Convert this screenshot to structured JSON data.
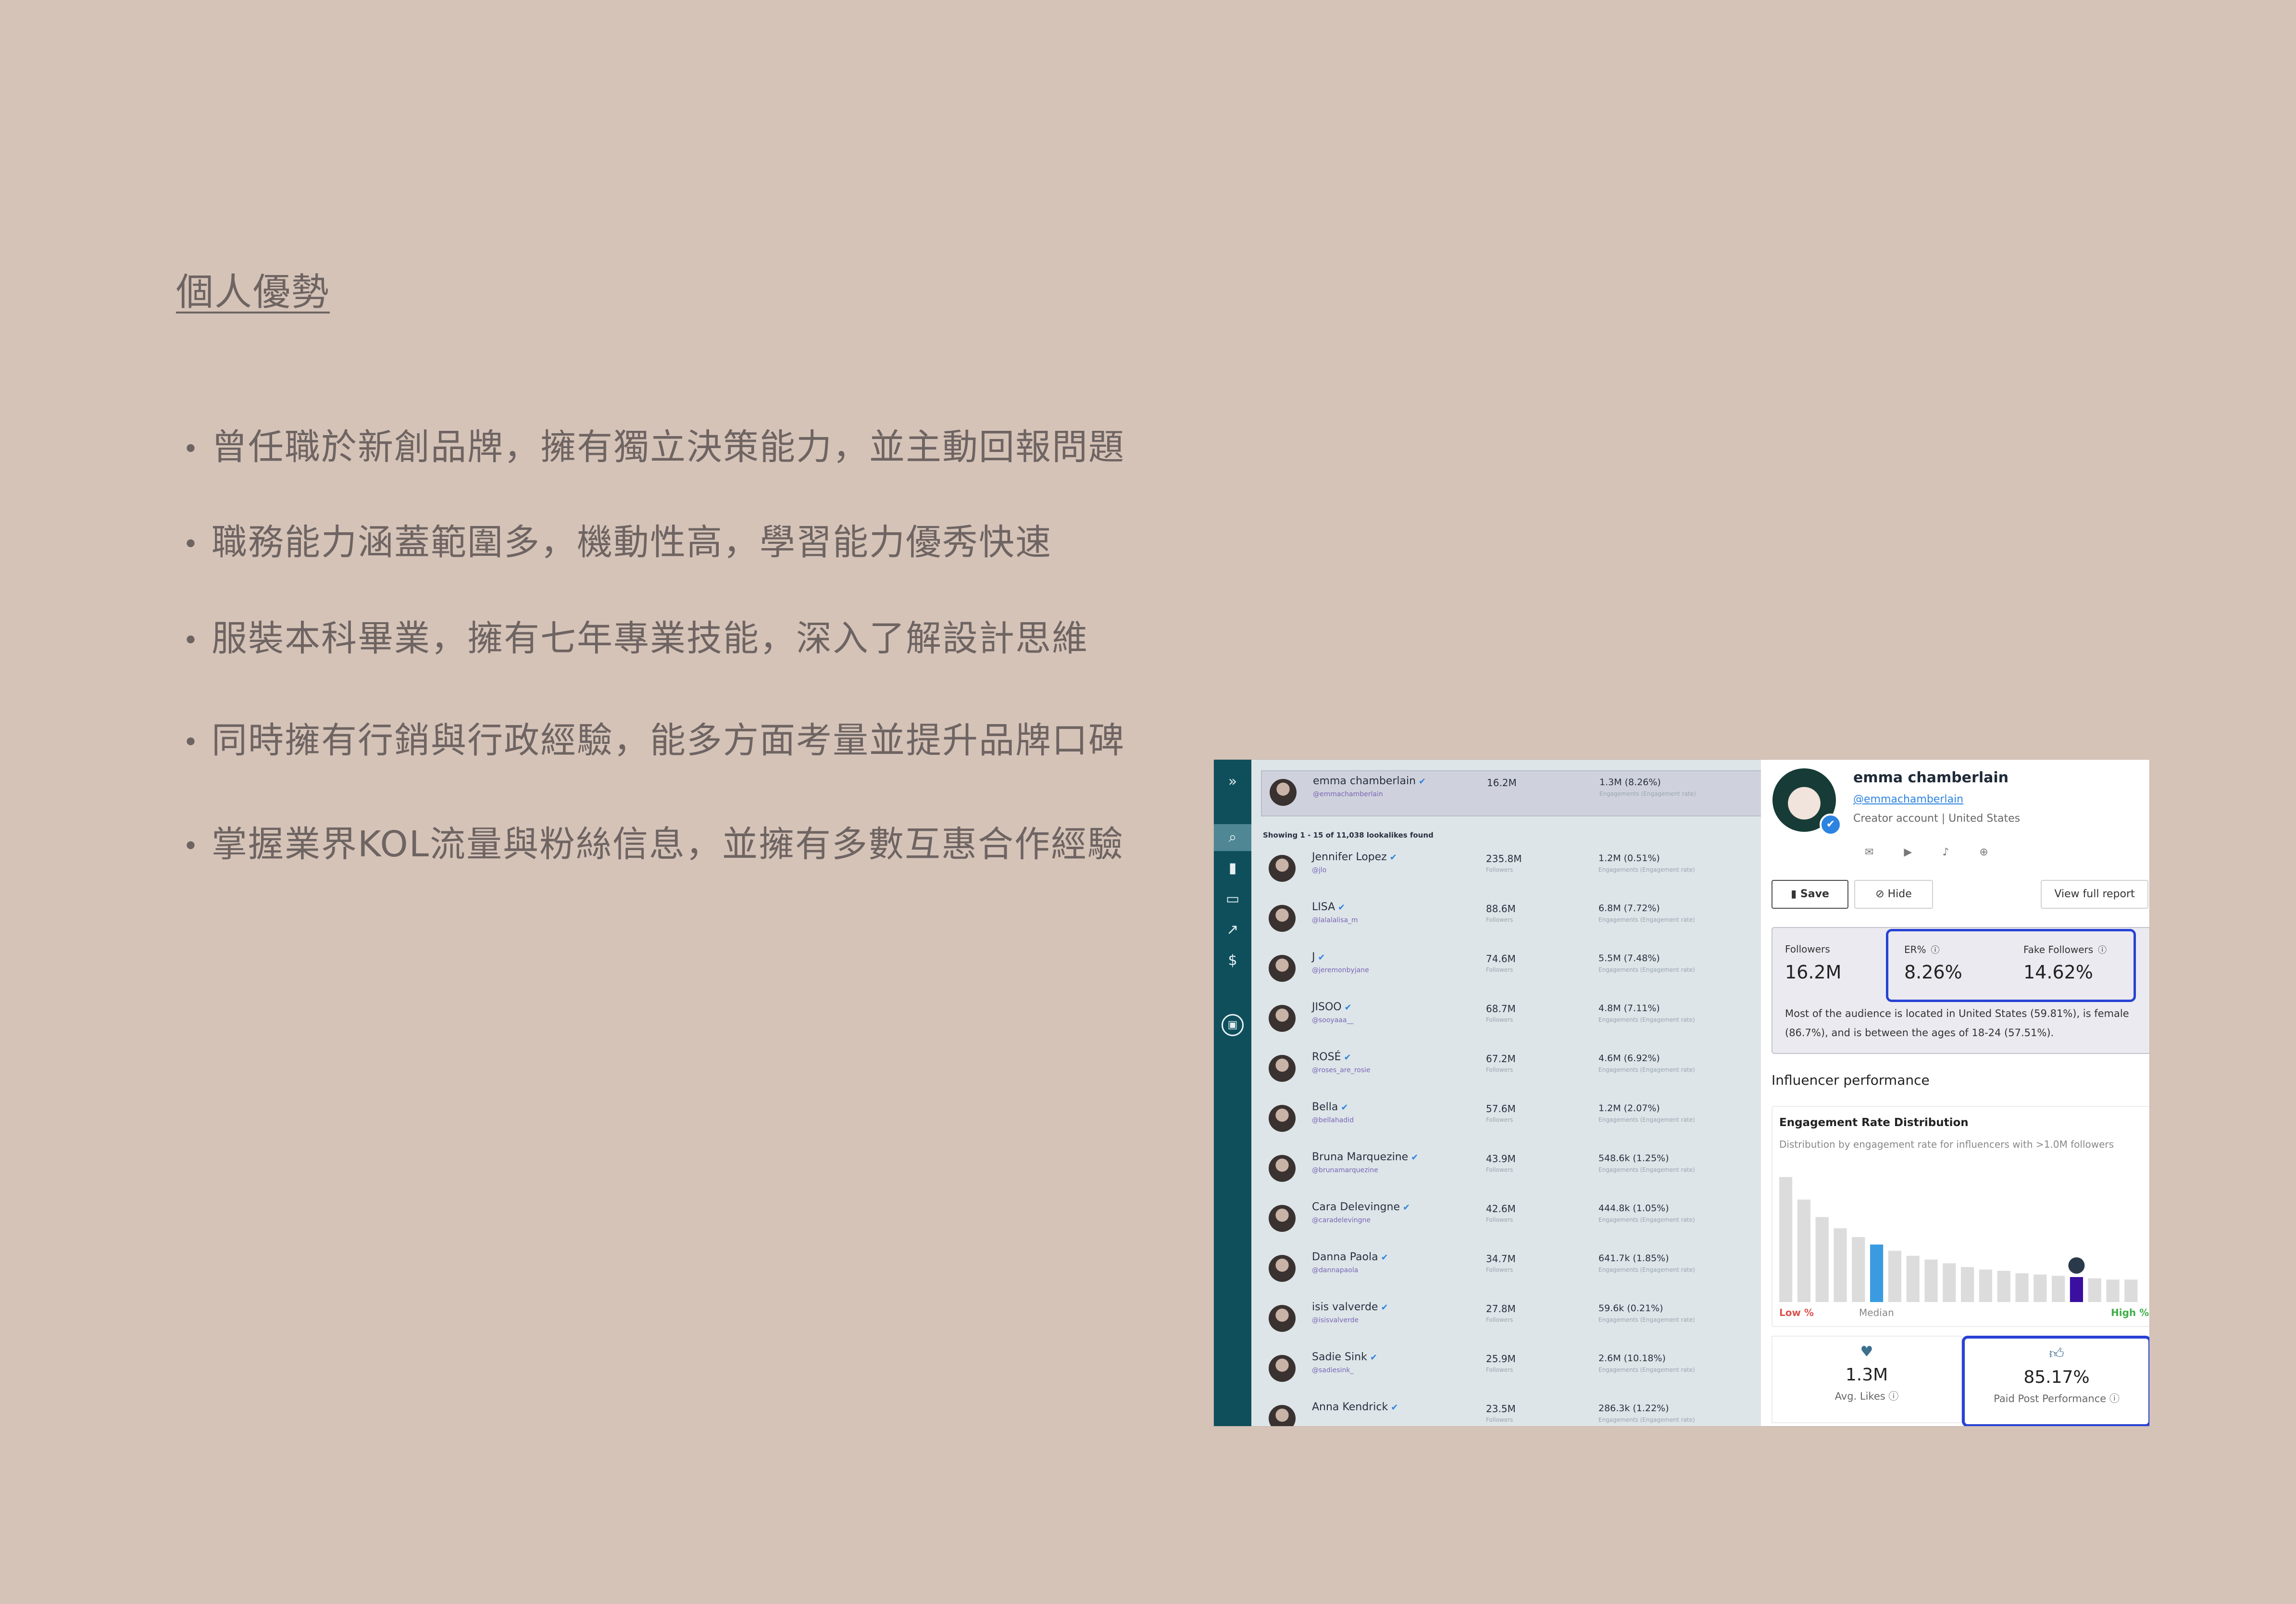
{
  "slide": {
    "heading": "個人優勢",
    "bullets": [
      "曾任職於新創品牌，擁有獨立決策能力，並主動回報問題",
      "職務能力涵蓋範圍多，機動性高，學習能力優秀快速",
      "服裝本科畢業，擁有七年專業技能，深入了解設計思維",
      "同時擁有行銷與行政經驗，能多方面考量並提升品牌口碑",
      "掌握業界KOL流量與粉絲信息，並擁有多數互惠合作經驗"
    ]
  },
  "sidebar": {
    "icons": [
      "expand-icon",
      "search-icon",
      "bookmark-icon",
      "inbox-icon",
      "trending-icon",
      "dollar-icon",
      "chat-icon"
    ],
    "glyphs": [
      "»",
      "⌕",
      "▮",
      "▭",
      "↗",
      "$",
      "▣"
    ]
  },
  "list": {
    "top": {
      "name": "emma chamberlain",
      "handle": "@emmachamberlain",
      "followers": "16.2M",
      "engagement": "1.3M (8.26%)",
      "engagement_label": "Engagements (Engagement rate)"
    },
    "showing": "Showing 1 - 15 of 11,038 lookalikes found",
    "followers_label": "Followers",
    "engagement_label": "Engagements (Engagement rate)",
    "rows": [
      {
        "name": "Jennifer Lopez",
        "handle": "@jlo",
        "followers": "235.8M",
        "engagement": "1.2M (0.51%)"
      },
      {
        "name": "LISA",
        "handle": "@lalalalisa_m",
        "followers": "88.6M",
        "engagement": "6.8M (7.72%)"
      },
      {
        "name": "J",
        "handle": "@jeremonbyjane",
        "followers": "74.6M",
        "engagement": "5.5M (7.48%)"
      },
      {
        "name": "JISOO",
        "handle": "@sooyaaa__",
        "followers": "68.7M",
        "engagement": "4.8M (7.11%)"
      },
      {
        "name": "ROSÉ",
        "handle": "@roses_are_rosie",
        "followers": "67.2M",
        "engagement": "4.6M (6.92%)"
      },
      {
        "name": "Bella",
        "handle": "@bellahadid",
        "followers": "57.6M",
        "engagement": "1.2M (2.07%)"
      },
      {
        "name": "Bruna Marquezine",
        "handle": "@brunamarquezine",
        "followers": "43.9M",
        "engagement": "548.6k (1.25%)"
      },
      {
        "name": "Cara Delevingne",
        "handle": "@caradelevingne",
        "followers": "42.6M",
        "engagement": "444.8k (1.05%)"
      },
      {
        "name": "Danna Paola",
        "handle": "@dannapaola",
        "followers": "34.7M",
        "engagement": "641.7k (1.85%)"
      },
      {
        "name": "isis valverde",
        "handle": "@isisvalverde",
        "followers": "27.8M",
        "engagement": "59.6k (0.21%)"
      },
      {
        "name": "Sadie Sink",
        "handle": "@sadiesink_",
        "followers": "25.9M",
        "engagement": "2.6M (10.18%)"
      },
      {
        "name": "Anna Kendrick",
        "handle": "",
        "followers": "23.5M",
        "engagement": "286.3k (1.22%)"
      }
    ]
  },
  "profile": {
    "name": "emma chamberlain",
    "handle": "@emmachamberlain",
    "meta": "Creator account  |  United States",
    "social_icons": "✉ ▶ ♪ ⊕",
    "save_label": "Save",
    "hide_label": "Hide",
    "report_label": "View full report",
    "stats": {
      "followers_label": "Followers",
      "followers_value": "16.2M",
      "er_label": "ER%",
      "er_value": "8.26%",
      "fake_label": "Fake Followers",
      "fake_value": "14.62%",
      "description": "Most of the audience is located in United States (59.81%), is female (86.7%), and is between the ages of 18-24 (57.51%)."
    },
    "performance_title": "Influencer performance",
    "chart_title": "Engagement Rate Distribution",
    "chart_subtitle": "Distribution by engagement rate for influencers with >1.0M followers",
    "low_label": "Low %",
    "median_label": "Median",
    "high_label": "High %",
    "avg_likes_value": "1.3M",
    "avg_likes_label": "Avg. Likes",
    "paid_value": "85.17%",
    "paid_label": "Paid Post Performance"
  },
  "colors": {
    "accent": "#2742d4",
    "median_bar": "#3a9be0",
    "user_bar": "#3b0fa0",
    "bar": "#dcdcdc"
  },
  "chart_data": {
    "type": "bar",
    "title": "Engagement Rate Distribution",
    "subtitle": "Distribution by engagement rate for influencers with >1.0M followers",
    "values": [
      100,
      82,
      68,
      59,
      52,
      46,
      41,
      37,
      34,
      31,
      28,
      26,
      25,
      23,
      22,
      21,
      20,
      19,
      18,
      18
    ],
    "median_index": 5,
    "highlight_index": 16
  }
}
